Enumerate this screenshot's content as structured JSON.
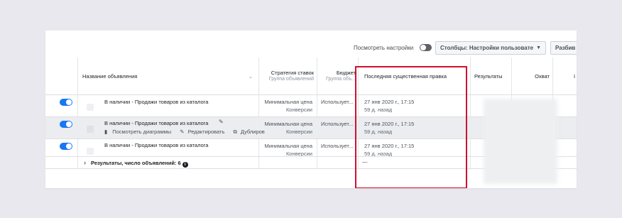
{
  "toolbar": {
    "view_settings_label": "Посмотреть настройки",
    "columns_label": "Столбцы: Настройки пользовате",
    "breakdown_label": "Разбив"
  },
  "headers": {
    "ad_name": "Название объявления",
    "bid_strategy": "Стратегия ставок",
    "bid_strategy_sub": "Группа объявлений",
    "budget": "Бюджет",
    "budget_sub": "Группа объ...",
    "last_edit": "Последняя существенная правка",
    "results": "Результаты",
    "reach": "Охват",
    "extra": "I"
  },
  "rows": [
    {
      "name": "В наличии - Продажи товаров из каталога",
      "bid": "Минимальная цена",
      "bid_sub": "Конверсии",
      "budget": "Использует...",
      "edit_date": "27 янв 2020 г., 17:15",
      "edit_ago": "59 д. назад"
    },
    {
      "name": "В наличии - Продажи товаров из каталога",
      "bid": "Минимальная цена",
      "bid_sub": "Конверсии",
      "budget": "Использует...",
      "edit_date": "27 янв 2020 г., 17:15",
      "edit_ago": "59 д. назад",
      "actions": {
        "view_charts": "Посмотреть диаграммы",
        "edit": "Редактировать",
        "duplicate": "Дублиров"
      }
    },
    {
      "name": "В наличии - Продажи товаров из каталога",
      "bid": "Минимальная цена",
      "bid_sub": "Конверсии",
      "budget": "Использует...",
      "edit_date": "27 янв 2020 г., 17:15",
      "edit_ago": "59 д. назад"
    }
  ],
  "footer": {
    "label": "Результаты, число объявлений: 6",
    "edit_dash": "—"
  },
  "colors": {
    "accent": "#1877f2",
    "highlight": "#d0102e"
  }
}
